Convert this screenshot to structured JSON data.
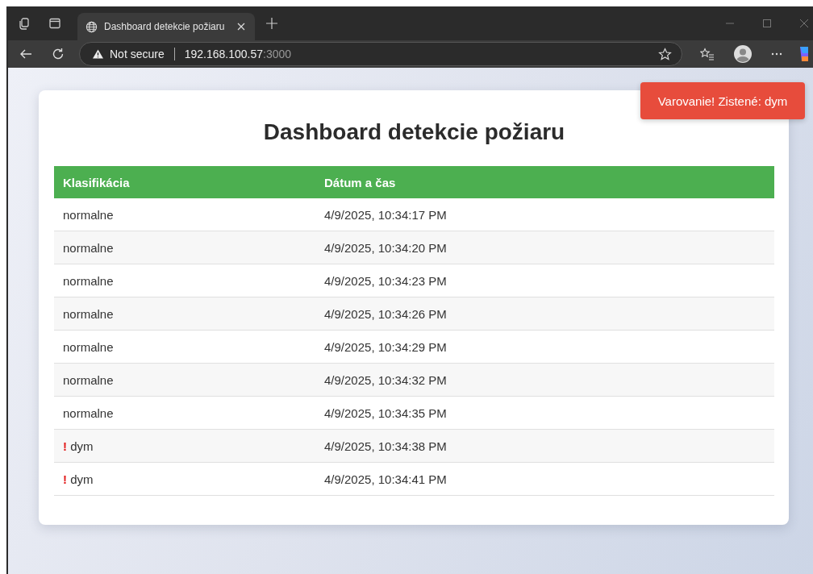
{
  "browser": {
    "tab": {
      "title": "Dashboard detekcie požiaru",
      "selected": true
    },
    "address": {
      "security": "Not secure",
      "host": "192.168.100.57",
      "port": ":3000"
    }
  },
  "toast": {
    "text": "Varovanie! Zistené: dym"
  },
  "page": {
    "title": "Dashboard detekcie požiaru",
    "table": {
      "columns": [
        "Klasifikácia",
        "Dátum a čas"
      ],
      "rows": [
        {
          "classification": "normalne",
          "time": "4/9/2025, 10:34:17 PM"
        },
        {
          "classification": "normalne",
          "time": "4/9/2025, 10:34:20 PM"
        },
        {
          "classification": "normalne",
          "time": "4/9/2025, 10:34:23 PM"
        },
        {
          "classification": "normalne",
          "time": "4/9/2025, 10:34:26 PM"
        },
        {
          "classification": "normalne",
          "time": "4/9/2025, 10:34:29 PM"
        },
        {
          "classification": "normalne",
          "time": "4/9/2025, 10:34:32 PM"
        },
        {
          "classification": "normalne",
          "time": "4/9/2025, 10:34:35 PM"
        },
        {
          "classification": "dym",
          "marker": "!",
          "time": "4/9/2025, 10:34:38 PM"
        },
        {
          "classification": "dym",
          "marker": "!",
          "time": "4/9/2025, 10:34:41 PM"
        }
      ]
    }
  }
}
